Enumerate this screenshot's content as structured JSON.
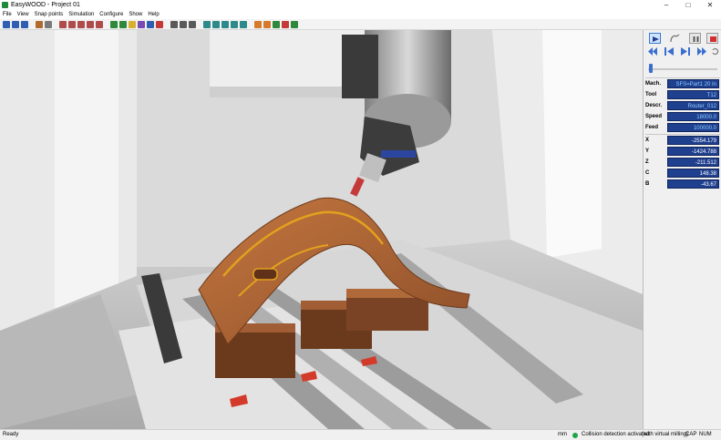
{
  "window": {
    "title": "EasyWOOD - Project 01"
  },
  "menu": [
    "File",
    "View",
    "Snap points",
    "Simulation",
    "Configure",
    "Show",
    "Help"
  ],
  "toolbar_colors": [
    "#2e5fb0",
    "#2e5fb0",
    "#2e5fb0",
    "#b06a2e",
    "#7a7a7a",
    "#b04b4b",
    "#b04b4b",
    "#b04b4b",
    "#b04b4b",
    "#b04b4b",
    "#2e8a3a",
    "#2e8a3a",
    "#d6b02e",
    "#7a4bb0",
    "#2e5fb0",
    "#c43a3a",
    "#5a5a5a",
    "#5a5a5a",
    "#5a5a5a",
    "#2e8a8a",
    "#2e8a8a",
    "#2e8a8a",
    "#2e8a8a",
    "#2e8a8a",
    "#d67a2e",
    "#d67a2e",
    "#2e8a3a",
    "#c43a3a",
    "#2e8a3a"
  ],
  "machine_info": {
    "mach": {
      "label": "Mach.",
      "value": "SFS=Part1 20 In"
    },
    "tool": {
      "label": "Tool",
      "value": "T12"
    },
    "descr": {
      "label": "Descr.",
      "value": "Router_012"
    },
    "speed": {
      "label": "Speed",
      "value": "18000.0"
    },
    "feed": {
      "label": "Feed",
      "value": "100000.0"
    }
  },
  "axes": [
    {
      "label": "X",
      "value": "-2554.179"
    },
    {
      "label": "Y",
      "value": "-1424.788"
    },
    {
      "label": "Z",
      "value": "-211.512"
    },
    {
      "label": "C",
      "value": "148.38"
    },
    {
      "label": "B",
      "value": "-43.67"
    }
  ],
  "status": {
    "ready": "Ready",
    "units": "mm",
    "collision": "Collision detection activated",
    "collision_extra": "(with virtual milling)",
    "cap": "CAP",
    "num": "NUM"
  },
  "colors": {
    "accent": "#3a78d8",
    "field_bg": "#1f3f8f",
    "wood": "#b5673a",
    "status_ok": "#22a34a"
  }
}
